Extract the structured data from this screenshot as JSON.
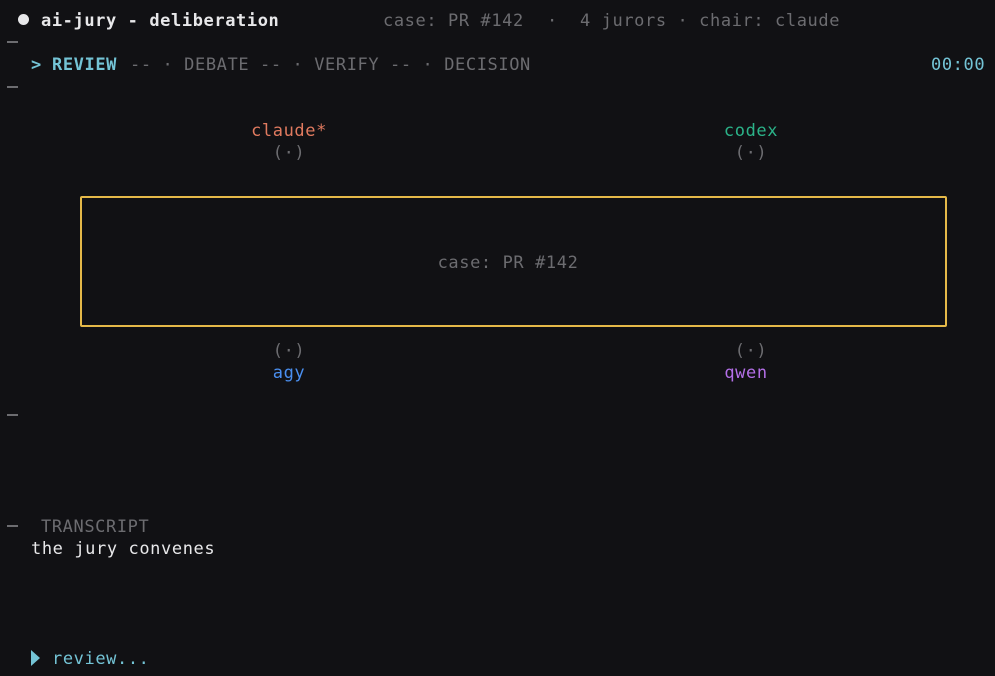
{
  "header": {
    "title": "ai-jury - deliberation",
    "case": "case: PR #142",
    "sep": "·",
    "jurors": "4 jurors · chair: claude"
  },
  "stages": {
    "prompt": ">",
    "current": "REVIEW",
    "rest": "-- · DEBATE -- · VERIFY -- · DECISION",
    "timer": "00:00"
  },
  "jurors": [
    {
      "name": "claude*",
      "indicator": "(·)",
      "color": "#e07a5f"
    },
    {
      "name": "codex",
      "indicator": "(·)",
      "color": "#2bb389"
    },
    {
      "name": "agy",
      "indicator": "(·)",
      "color": "#4a8ff0"
    },
    {
      "name": "qwen",
      "indicator": "(·)",
      "color": "#b46fe8"
    }
  ],
  "case_box": {
    "label": "case: PR #142",
    "border_color": "#e5b949"
  },
  "transcript": {
    "heading": "TRANSCRIPT",
    "lines": [
      "the jury convenes"
    ]
  },
  "status": {
    "icon": "play-triangle-icon",
    "text": "review..."
  }
}
